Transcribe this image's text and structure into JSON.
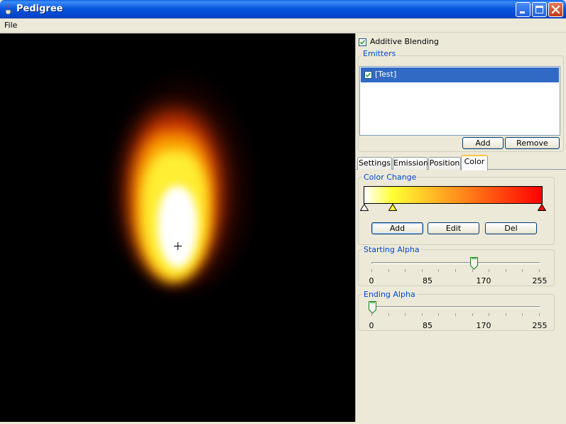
{
  "window": {
    "title": "Pedigree"
  },
  "menu": {
    "file": "File"
  },
  "options": {
    "additive_blending_label": "Additive Blending",
    "additive_blending_checked": true
  },
  "emitters": {
    "group_title": "Emitters",
    "items": [
      {
        "label": "[Test]",
        "checked": true,
        "selected": true
      }
    ],
    "add_label": "Add",
    "remove_label": "Remove"
  },
  "tabs": [
    {
      "label": "Settings",
      "active": false
    },
    {
      "label": "Emission",
      "active": false
    },
    {
      "label": "Position",
      "active": false
    },
    {
      "label": "Color",
      "active": true
    }
  ],
  "color_change": {
    "group_title": "Color Change",
    "gradient_colors": [
      "#ffffff",
      "#ffff33",
      "#ff0000"
    ],
    "markers": [
      {
        "position": 0.0,
        "color": "#ffffff"
      },
      {
        "position": 0.16,
        "color": "#ffff33"
      },
      {
        "position": 1.0,
        "color": "#ff0000"
      }
    ],
    "add_label": "Add",
    "edit_label": "Edit",
    "del_label": "Del"
  },
  "starting_alpha": {
    "group_title": "Starting Alpha",
    "min": 0,
    "max": 255,
    "value": 155,
    "tick_labels": [
      "0",
      "85",
      "170",
      "255"
    ]
  },
  "ending_alpha": {
    "group_title": "Ending Alpha",
    "min": 0,
    "max": 255,
    "value": 0,
    "tick_labels": [
      "0",
      "85",
      "170",
      "255"
    ]
  },
  "icons": {
    "app": "java-coffee-cup-icon",
    "minimize": "minimize-icon",
    "maximize": "maximize-icon",
    "close": "close-icon",
    "emitter_origin": "crosshair-icon"
  },
  "colors": {
    "titlebar": "#0a58e0",
    "selection": "#316ac5",
    "group_title": "#0046d5",
    "canvas_background": "#000000",
    "active_tab_accent": "#ffc83c"
  }
}
